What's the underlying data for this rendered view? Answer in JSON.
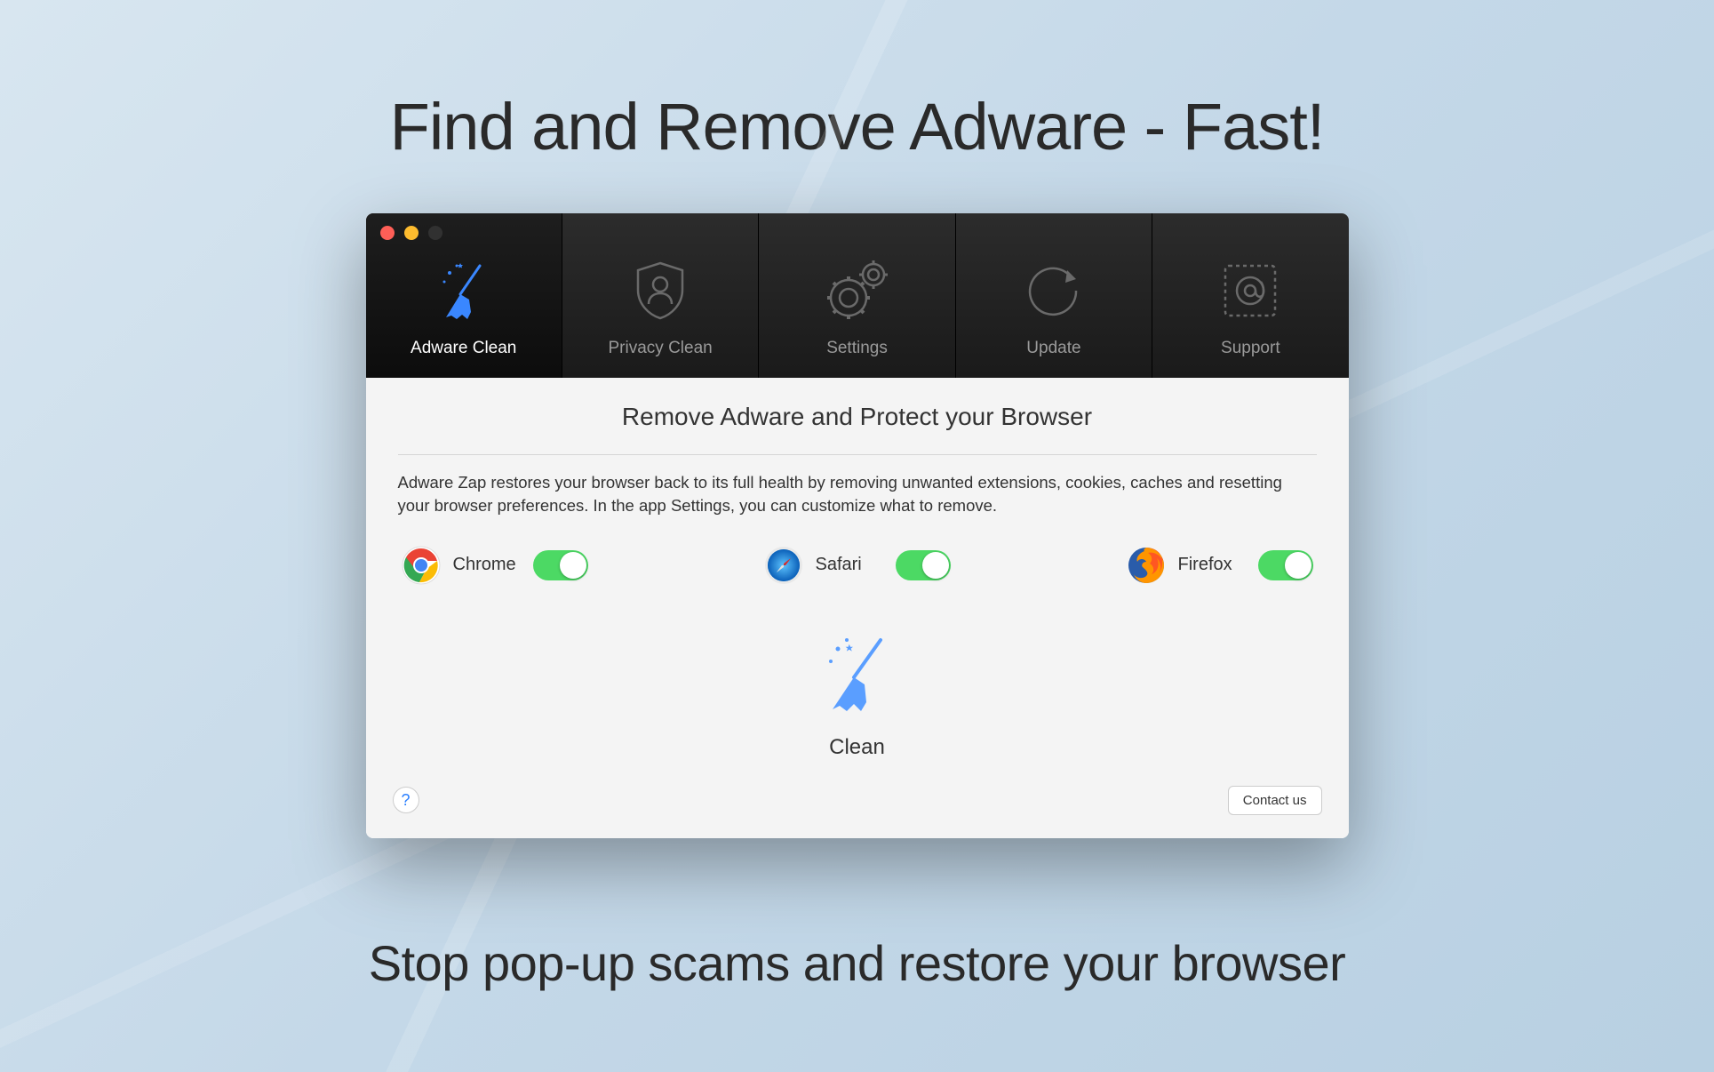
{
  "page": {
    "title": "Find and Remove Adware - Fast!",
    "subtitle": "Stop pop-up scams and restore your browser"
  },
  "tabs": [
    {
      "label": "Adware Clean",
      "icon": "broom"
    },
    {
      "label": "Privacy Clean",
      "icon": "shield-user"
    },
    {
      "label": "Settings",
      "icon": "gears"
    },
    {
      "label": "Update",
      "icon": "refresh"
    },
    {
      "label": "Support",
      "icon": "stamp-at"
    }
  ],
  "main": {
    "heading": "Remove Adware and Protect your Browser",
    "description": "Adware Zap restores your browser back to its full health by removing unwanted extensions, cookies, caches and resetting your browser preferences. In the app Settings, you can customize what to remove.",
    "browsers": [
      {
        "name": "Chrome",
        "enabled": true
      },
      {
        "name": "Safari",
        "enabled": true
      },
      {
        "name": "Firefox",
        "enabled": true
      }
    ],
    "clean_label": "Clean",
    "help_label": "?",
    "contact_label": "Contact us"
  }
}
